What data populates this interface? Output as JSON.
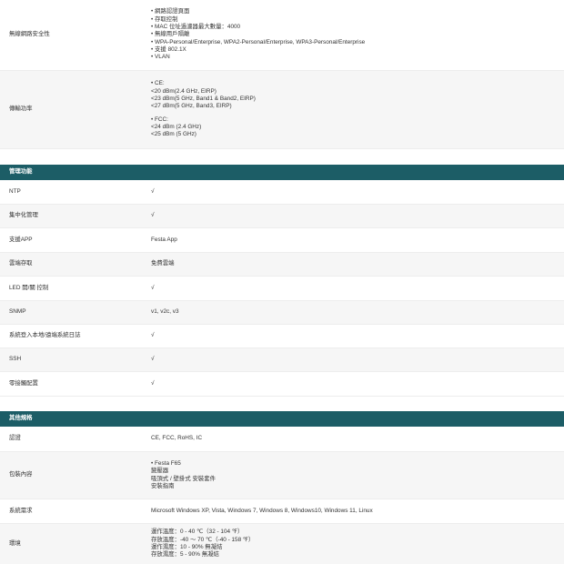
{
  "wireless_security": {
    "label": "無線網路安全性",
    "lines": [
      "• 網路認證頁面",
      "• 存取控制",
      "• MAC 位址過濾器最大數量：4000",
      "• 無線用戶隔離",
      "• WPA-Personal/Enterprise, WPA2-Personal/Enterprise, WPA3-Personal/Enterprise",
      "• 支援 802.1X",
      "• VLAN"
    ]
  },
  "tx_power": {
    "label": "傳輸功率",
    "ce_lines": [
      "• CE:",
      "<20 dBm(2.4 GHz, EIRP)",
      "<23 dBm(5 GHz, Band1 & Band2, EIRP)",
      "<27 dBm(5 GHz, Band3, EIRP)"
    ],
    "fcc_lines": [
      "• FCC:",
      "<24 dBm (2.4 GHz)",
      "<25 dBm (5 GHz)"
    ]
  },
  "management": {
    "title": "管理功能",
    "rows": [
      {
        "label": "NTP",
        "value": "√"
      },
      {
        "label": "集中化管理",
        "value": "√"
      },
      {
        "label": "支援APP",
        "value": "Festa App"
      },
      {
        "label": "雲端存取",
        "value": "免費雲端"
      },
      {
        "label": "LED 開/關 控制",
        "value": "√"
      },
      {
        "label": "SNMP",
        "value": "v1, v2c, v3"
      },
      {
        "label": "系統登入本地/遠端系統日誌",
        "value": "√"
      },
      {
        "label": "SSH",
        "value": "√"
      },
      {
        "label": "零接觸配置",
        "value": "√"
      }
    ]
  },
  "other": {
    "title": "其他規格",
    "certification": {
      "label": "認證",
      "value": "CE, FCC, RoHS, IC"
    },
    "package": {
      "label": "包裝內容",
      "lines": [
        "• Festa F65",
        "變壓器",
        "吸頂式 / 壁掛式 安裝套件",
        "安裝指南"
      ]
    },
    "system": {
      "label": "系統需求",
      "value": "Microsoft Windows XP, Vista, Windows 7, Windows 8, Windows10, Windows 11, Linux"
    },
    "environment": {
      "label": "環境",
      "lines": [
        "運作溫度：0 - 40 ℃（32 - 104 ℉）",
        "存放溫度：-40 ～ 70 ℃（-40 - 158 ℉）",
        "運作濕度：10 - 90% 無凝結",
        "存放濕度：5 - 90% 無凝結"
      ]
    }
  }
}
